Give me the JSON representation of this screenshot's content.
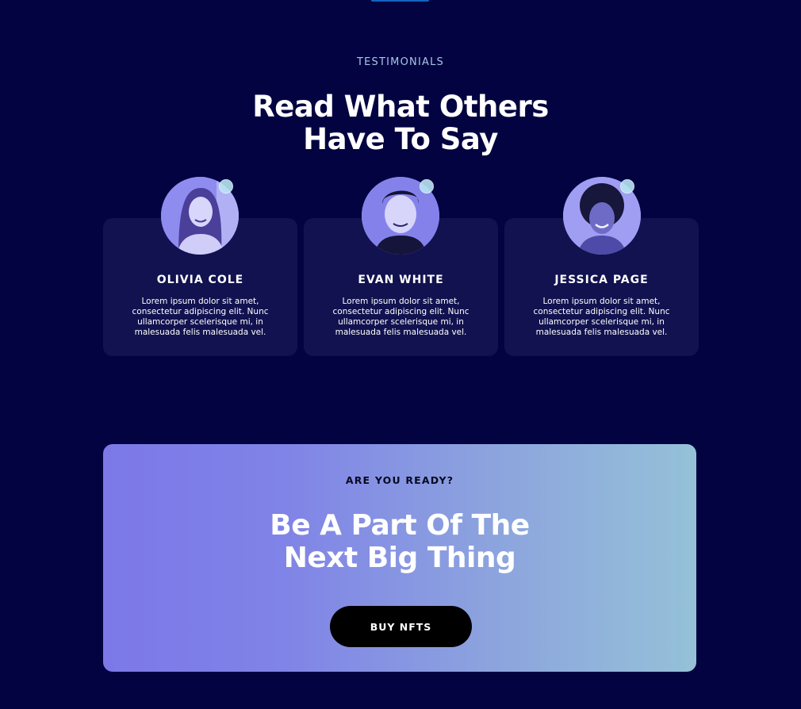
{
  "testimonials": {
    "eyebrow": "TESTIMONIALS",
    "title_line1": "Read What Others",
    "title_line2": "Have To Say",
    "items": [
      {
        "name": "OLIVIA COLE",
        "quote": "Lorem ipsum dolor sit amet, consectetur adipiscing elit. Nunc ullamcorper scelerisque mi, in malesuada felis malesuada vel."
      },
      {
        "name": "EVAN WHITE",
        "quote": "Lorem ipsum dolor sit amet, consectetur adipiscing elit. Nunc ullamcorper scelerisque mi, in malesuada felis malesuada vel."
      },
      {
        "name": "JESSICA PAGE",
        "quote": "Lorem ipsum dolor sit amet, consectetur adipiscing elit. Nunc ullamcorper scelerisque mi, in malesuada felis malesuada vel."
      }
    ]
  },
  "cta": {
    "eyebrow": "ARE YOU READY?",
    "title_line1": "Be A Part Of The",
    "title_line2": "Next Big Thing",
    "button_label": "BUY NFTS"
  },
  "colors": {
    "page_background": "#020340",
    "card_background": "#11124f",
    "accent_bar": "#1565c0",
    "eyebrow_text": "#a9c5e8",
    "cta_gradient_start": "#7c78e8",
    "cta_gradient_end": "#95c1d8",
    "button_background": "#000000"
  },
  "icons": [
    "avatar-photo",
    "status-dot"
  ]
}
